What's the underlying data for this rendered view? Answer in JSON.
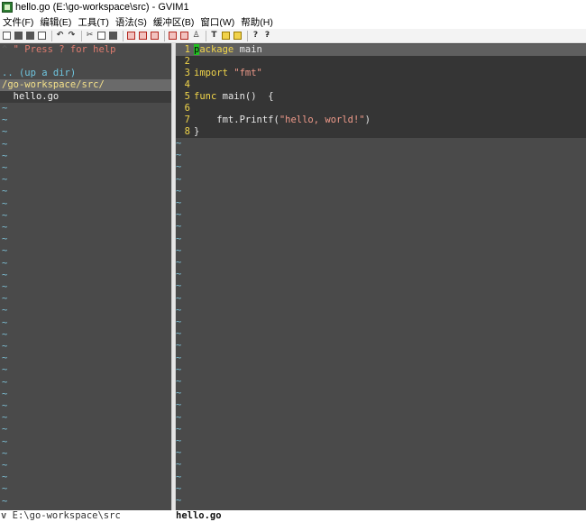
{
  "window": {
    "title": "hello.go (E:\\go-workspace\\src) - GVIM1"
  },
  "menu": [
    "文件(F)",
    "编辑(E)",
    "工具(T)",
    "语法(S)",
    "缓冲区(B)",
    "窗口(W)",
    "帮助(H)"
  ],
  "toolbar": {
    "icons": [
      "open-icon",
      "save-icon",
      "save-all-icon",
      "print-icon",
      "undo-icon",
      "redo-icon",
      "cut-icon",
      "copy-icon",
      "paste-icon",
      "find-replace-icon",
      "find-next-icon",
      "find-prev-icon",
      "load-session-icon",
      "save-session-icon",
      "run-script-icon",
      "make-icon",
      "shell-icon",
      "ctags-icon",
      "help-icon",
      "find-help-icon"
    ],
    "help_glyph": "?",
    "find_help_glyph": "?̵"
  },
  "explorer": {
    "help_line": "\" Press ? for help",
    "up_dir": ".. (up a dir)",
    "current_dir": "/go-workspace/src/",
    "file": "hello.go",
    "empty_marker": "~",
    "empty_rows": 34
  },
  "editor": {
    "cursor_char": "p",
    "lines": [
      {
        "num": "1",
        "keyword": "ackage",
        "text": " main"
      },
      {
        "num": "2",
        "keyword": "",
        "text": ""
      },
      {
        "num": "3",
        "keyword": "import",
        "string": "\"fmt\""
      },
      {
        "num": "4",
        "keyword": "",
        "text": ""
      },
      {
        "num": "5",
        "keyword": "func",
        "text": " main()  {"
      },
      {
        "num": "6",
        "keyword": "",
        "text": ""
      },
      {
        "num": "7",
        "keyword": "",
        "text": "    fmt.Printf(",
        "string": "\"hello, world!\"",
        "tail": ")"
      },
      {
        "num": "8",
        "keyword": "",
        "text": "}"
      }
    ],
    "empty_marker": "~",
    "empty_rows": 31
  },
  "status": {
    "left": "E:\\go-workspace\\src",
    "right": "hello.go",
    "chevron": "v"
  },
  "colors": {
    "background": "#4a4a4a",
    "line_number": "#f2d64a",
    "comment": "#e07c6f",
    "directory": "#f3e08a",
    "string": "#ef9a8a",
    "cursor": "#20c020"
  }
}
